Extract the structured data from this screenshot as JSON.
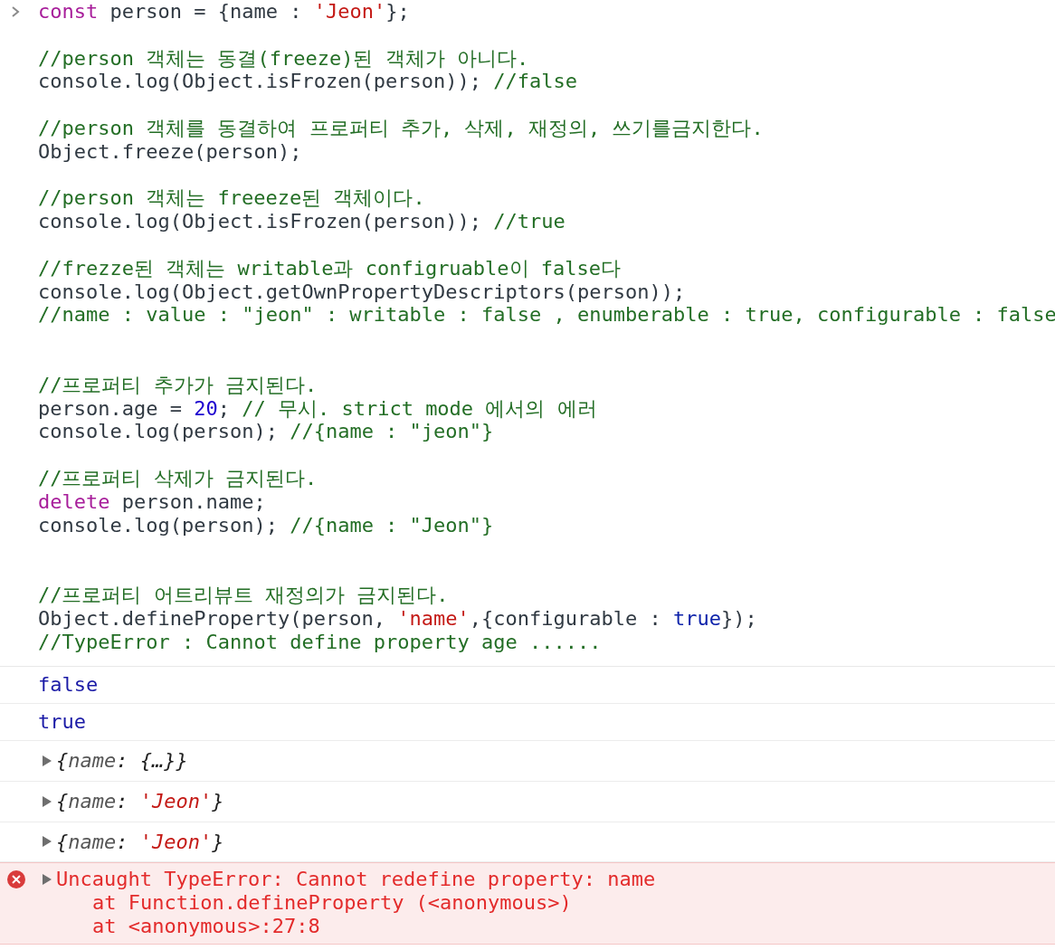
{
  "input": {
    "lines": [
      {
        "kind": "code",
        "tokens": [
          {
            "kind": "keyword",
            "text": "const"
          },
          {
            "kind": "plain",
            "text": " person = {name : "
          },
          {
            "kind": "string",
            "text": "'Jeon'"
          },
          {
            "kind": "plain",
            "text": "};"
          }
        ]
      },
      {
        "kind": "blank"
      },
      {
        "kind": "code",
        "tokens": [
          {
            "kind": "comment",
            "text": "//person 객체는 동결(freeze)된 객체가 아니다."
          }
        ]
      },
      {
        "kind": "code",
        "tokens": [
          {
            "kind": "plain",
            "text": "console.log(Object.isFrozen(person)); "
          },
          {
            "kind": "comment",
            "text": "//false"
          }
        ]
      },
      {
        "kind": "blank"
      },
      {
        "kind": "code",
        "tokens": [
          {
            "kind": "comment",
            "text": "//person 객체를 동결하여 프로퍼티 추가, 삭제, 재정의, 쓰기를금지한다."
          }
        ]
      },
      {
        "kind": "code",
        "tokens": [
          {
            "kind": "plain",
            "text": "Object.freeze(person);"
          }
        ]
      },
      {
        "kind": "blank"
      },
      {
        "kind": "code",
        "tokens": [
          {
            "kind": "comment",
            "text": "//person 객체는 freeeze된 객체이다."
          }
        ]
      },
      {
        "kind": "code",
        "tokens": [
          {
            "kind": "plain",
            "text": "console.log(Object.isFrozen(person)); "
          },
          {
            "kind": "comment",
            "text": "//true"
          }
        ]
      },
      {
        "kind": "blank"
      },
      {
        "kind": "code",
        "tokens": [
          {
            "kind": "comment",
            "text": "//frezze된 객체는 writable과 configruable이 false다"
          }
        ]
      },
      {
        "kind": "code",
        "tokens": [
          {
            "kind": "plain",
            "text": "console.log(Object.getOwnPropertyDescriptors(person));"
          }
        ]
      },
      {
        "kind": "code",
        "tokens": [
          {
            "kind": "comment",
            "text": "//name : value : \"jeon\" : writable : false , enumberable : true, configurable : false"
          }
        ]
      },
      {
        "kind": "blank"
      },
      {
        "kind": "blank"
      },
      {
        "kind": "code",
        "tokens": [
          {
            "kind": "comment",
            "text": "//프로퍼티 추가가 금지된다."
          }
        ]
      },
      {
        "kind": "code",
        "tokens": [
          {
            "kind": "plain",
            "text": "person.age = "
          },
          {
            "kind": "number",
            "text": "20"
          },
          {
            "kind": "plain",
            "text": "; "
          },
          {
            "kind": "comment",
            "text": "// 무시. strict mode 에서의 에러"
          }
        ]
      },
      {
        "kind": "code",
        "tokens": [
          {
            "kind": "plain",
            "text": "console.log(person); "
          },
          {
            "kind": "comment",
            "text": "//{name : \"jeon\"}"
          }
        ]
      },
      {
        "kind": "blank"
      },
      {
        "kind": "code",
        "tokens": [
          {
            "kind": "comment",
            "text": "//프로퍼티 삭제가 금지된다."
          }
        ]
      },
      {
        "kind": "code",
        "tokens": [
          {
            "kind": "keyword",
            "text": "delete"
          },
          {
            "kind": "plain",
            "text": " person.name;"
          }
        ]
      },
      {
        "kind": "code",
        "tokens": [
          {
            "kind": "plain",
            "text": "console.log(person); "
          },
          {
            "kind": "comment",
            "text": "//{name : \"Jeon\"}"
          }
        ]
      },
      {
        "kind": "blank"
      },
      {
        "kind": "blank"
      },
      {
        "kind": "code",
        "tokens": [
          {
            "kind": "comment",
            "text": "//프로퍼티 어트리뷰트 재정의가 금지된다."
          }
        ]
      },
      {
        "kind": "code",
        "tokens": [
          {
            "kind": "plain",
            "text": "Object.defineProperty(person, "
          },
          {
            "kind": "string",
            "text": "'name'"
          },
          {
            "kind": "plain",
            "text": ",{configurable : "
          },
          {
            "kind": "boolean",
            "text": "true"
          },
          {
            "kind": "plain",
            "text": "});"
          }
        ]
      },
      {
        "kind": "code",
        "tokens": [
          {
            "kind": "comment",
            "text": "//TypeError : Cannot define property age ......"
          }
        ]
      }
    ]
  },
  "messages": [
    {
      "kind": "value",
      "text": "false"
    },
    {
      "kind": "value",
      "text": "true"
    },
    {
      "kind": "object",
      "expanded": false,
      "tokens": [
        {
          "kind": "punct",
          "text": "{"
        },
        {
          "kind": "key",
          "text": "name"
        },
        {
          "kind": "punct",
          "text": ": {…}}"
        }
      ]
    },
    {
      "kind": "object",
      "expanded": false,
      "tokens": [
        {
          "kind": "punct",
          "text": "{"
        },
        {
          "kind": "key",
          "text": "name"
        },
        {
          "kind": "punct",
          "text": ": "
        },
        {
          "kind": "string",
          "text": "'Jeon'"
        },
        {
          "kind": "punct",
          "text": "}"
        }
      ]
    },
    {
      "kind": "object",
      "expanded": false,
      "tokens": [
        {
          "kind": "punct",
          "text": "{"
        },
        {
          "kind": "key",
          "text": "name"
        },
        {
          "kind": "punct",
          "text": ": "
        },
        {
          "kind": "string",
          "text": "'Jeon'"
        },
        {
          "kind": "punct",
          "text": "}"
        }
      ]
    },
    {
      "kind": "error",
      "expanded": false,
      "text": "Uncaught TypeError: Cannot redefine property: name",
      "stack": [
        "at Function.defineProperty (<anonymous>)",
        "at <anonymous>:27:8"
      ]
    }
  ]
}
